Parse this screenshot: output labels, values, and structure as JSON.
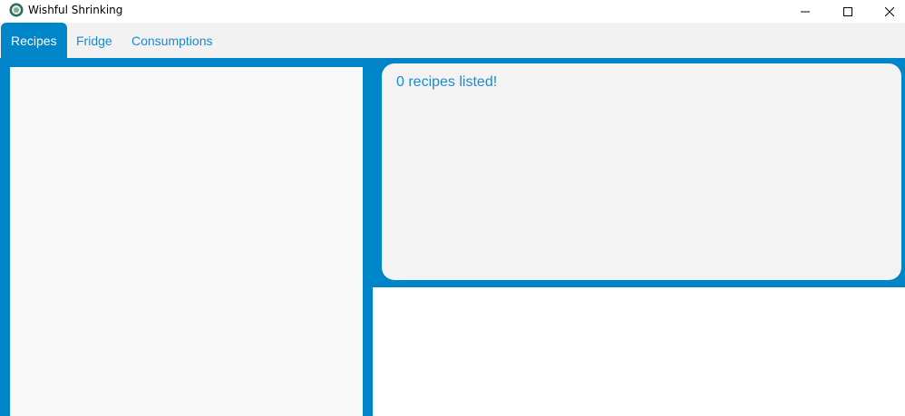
{
  "window": {
    "title": "Wishful Shrinking",
    "icon": "app-logo-icon",
    "controls": [
      "minimize-icon",
      "maximize-icon",
      "close-icon"
    ]
  },
  "tabs": [
    {
      "label": "Recipes",
      "active": true
    },
    {
      "label": "Fridge",
      "active": false
    },
    {
      "label": "Consumptions",
      "active": false
    }
  ],
  "result_display": {
    "text": "0 recipes listed!"
  },
  "colors": {
    "accent": "#0085c8",
    "tab_text": "#1a8ad1",
    "panel_bg": "#f9f9f9",
    "result_bg": "#f3f3f3"
  }
}
